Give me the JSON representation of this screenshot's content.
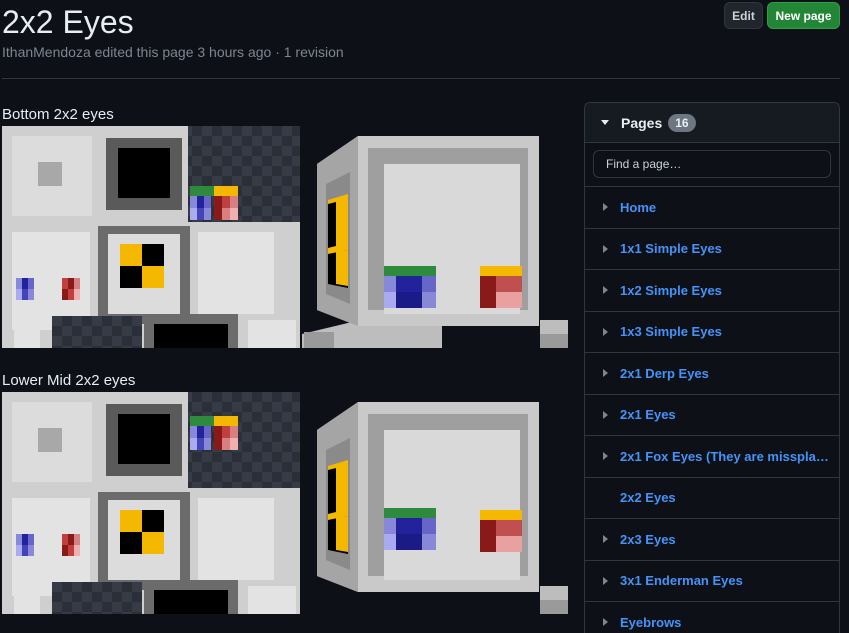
{
  "header": {
    "title": "2x2 Eyes",
    "meta": "IthanMendoza edited this page 3 hours ago · 1 revision",
    "edit_label": "Edit",
    "new_page_label": "New page"
  },
  "sections": [
    {
      "title": "Bottom 2x2 eyes",
      "image_alt": "Bottom 2x2 eyes texture"
    },
    {
      "title": "Lower Mid 2x2 eyes",
      "image_alt": "Lower Mid 2x2 eyes texture"
    }
  ],
  "sidebar": {
    "pages_label": "Pages",
    "count": "16",
    "find_placeholder": "Find a page…",
    "items": [
      {
        "label": "Home",
        "expandable": true
      },
      {
        "label": "1x1 Simple Eyes",
        "expandable": true
      },
      {
        "label": "1x2 Simple Eyes",
        "expandable": true
      },
      {
        "label": "1x3 Simple Eyes",
        "expandable": true
      },
      {
        "label": "2x1 Derp Eyes",
        "expandable": true
      },
      {
        "label": "2x1 Eyes",
        "expandable": true
      },
      {
        "label": "2x1 Fox Eyes (They are missplac…",
        "expandable": true
      },
      {
        "label": "2x2 Eyes",
        "expandable": false
      },
      {
        "label": "2x3 Eyes",
        "expandable": true
      },
      {
        "label": "3x1 Enderman Eyes",
        "expandable": true
      },
      {
        "label": "Eyebrows",
        "expandable": true
      }
    ]
  },
  "colors": {
    "background": "#0d1117",
    "link": "#4493f8",
    "primary_button": "#238636",
    "eye_blue": "#22229a",
    "eye_red": "#8a1a1a",
    "eye_yellow": "#f5b800",
    "eye_green": "#2e8b3e"
  }
}
